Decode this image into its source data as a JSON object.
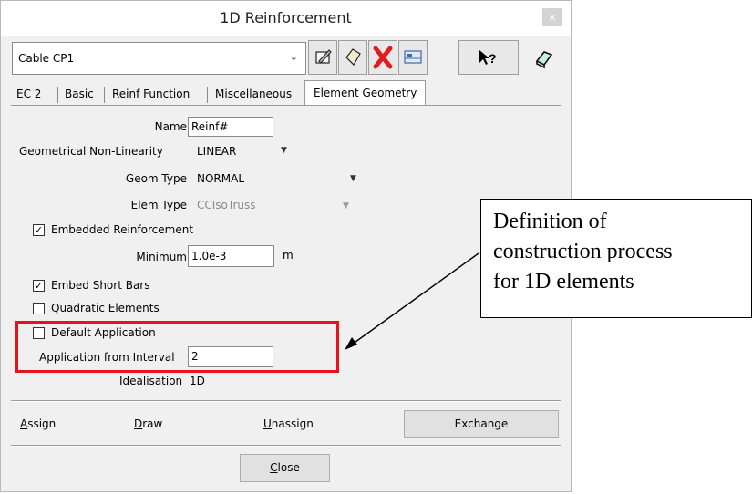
{
  "window": {
    "title": "1D Reinforcement",
    "close_glyph": "×"
  },
  "combo": {
    "value": "Cable CP1",
    "arrow": "⌄"
  },
  "toolbar": {
    "icons": [
      "edit-icon",
      "new-item-icon",
      "delete-icon",
      "table-icon",
      "help-pointer-icon",
      "eraser-icon"
    ]
  },
  "tabs": [
    {
      "label": "EC 2"
    },
    {
      "label": "Basic"
    },
    {
      "label": "Reinf Function"
    },
    {
      "label": "Miscellaneous"
    },
    {
      "label": "Element Geometry",
      "active": true
    }
  ],
  "form": {
    "name_label": "Name",
    "name_value": "Reinf#",
    "geom_nonlin_label": "Geometrical Non-Linearity",
    "geom_nonlin_value": "LINEAR",
    "geom_type_label": "Geom Type",
    "geom_type_value": "NORMAL",
    "elem_type_label": "Elem Type",
    "elem_type_value": "CCIsoTruss",
    "embedded_label": "Embedded Reinforcement",
    "embedded_checked": true,
    "minimum_label": "Minimum",
    "minimum_value": "1.0e-3",
    "minimum_unit": "m",
    "embed_short_label": "Embed Short Bars",
    "embed_short_checked": true,
    "quadratic_label": "Quadratic Elements",
    "quadratic_checked": false,
    "default_app_label": "Default Application",
    "default_app_checked": false,
    "app_interval_label": "Application from Interval",
    "app_interval_value": "2",
    "idealisation_label": "Idealisation",
    "idealisation_value": "1D"
  },
  "actions": {
    "assign_first": "A",
    "assign_rest": "ssign",
    "draw_first": "D",
    "draw_rest": "raw",
    "unassign_first": "U",
    "unassign_rest": "nassign",
    "exchange": "Exchange"
  },
  "footer": {
    "close_first": "C",
    "close_rest": "lose"
  },
  "annotation": {
    "lines": [
      "Definition of",
      "construction process",
      "for 1D elements"
    ],
    "highlight_color": "#e8121b"
  }
}
